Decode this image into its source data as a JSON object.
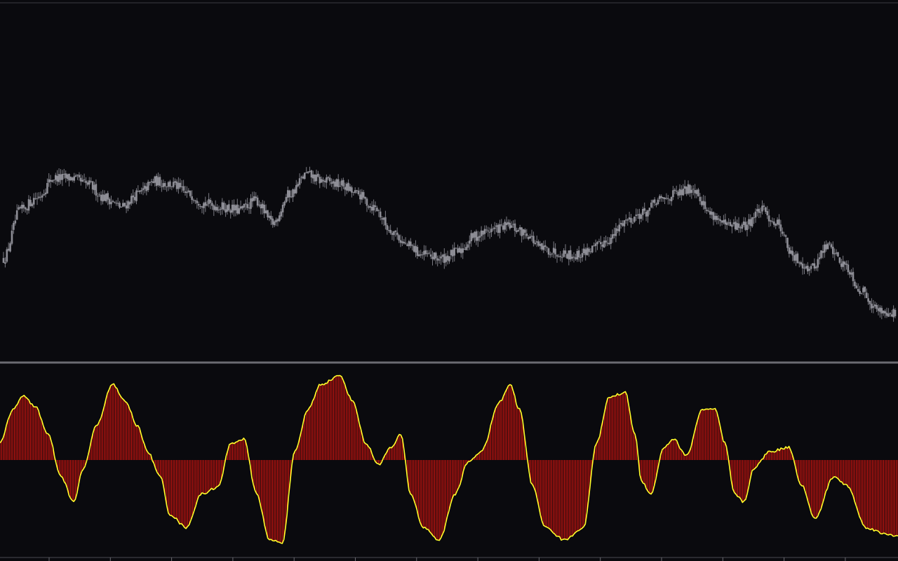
{
  "theme": {
    "background": "#0a0a0e",
    "separator": "#6b6b72",
    "candle": "#8e8e96",
    "wick": "#7a7a82",
    "histogram": "#e0140f",
    "signal": "#ffff2a"
  },
  "chart_data": [
    {
      "type": "candlestick",
      "grid": false,
      "legend": "none",
      "ylim": [
        0,
        100
      ],
      "close_anchors": [
        [
          0,
          22
        ],
        [
          10,
          37
        ],
        [
          20,
          41
        ],
        [
          30,
          47
        ],
        [
          40,
          47
        ],
        [
          50,
          45
        ],
        [
          60,
          41
        ],
        [
          70,
          38
        ],
        [
          80,
          42
        ],
        [
          90,
          46
        ],
        [
          100,
          45
        ],
        [
          110,
          42
        ],
        [
          120,
          39
        ],
        [
          130,
          38
        ],
        [
          140,
          37
        ],
        [
          150,
          40
        ],
        [
          160,
          33
        ],
        [
          170,
          42
        ],
        [
          180,
          48
        ],
        [
          190,
          46
        ],
        [
          200,
          45
        ],
        [
          210,
          42
        ],
        [
          220,
          38
        ],
        [
          230,
          31
        ],
        [
          240,
          26
        ],
        [
          250,
          23
        ],
        [
          260,
          22
        ],
        [
          270,
          24
        ],
        [
          280,
          29
        ],
        [
          290,
          31
        ],
        [
          300,
          32
        ],
        [
          310,
          30
        ],
        [
          320,
          25
        ],
        [
          330,
          24
        ],
        [
          340,
          23
        ],
        [
          350,
          25
        ],
        [
          360,
          28
        ],
        [
          370,
          34
        ],
        [
          380,
          36
        ],
        [
          390,
          40
        ],
        [
          400,
          42
        ],
        [
          410,
          44
        ],
        [
          420,
          36
        ],
        [
          430,
          32
        ],
        [
          440,
          32
        ],
        [
          450,
          37
        ],
        [
          460,
          33
        ],
        [
          470,
          22
        ],
        [
          480,
          19
        ],
        [
          490,
          26
        ],
        [
          500,
          20
        ],
        [
          510,
          12
        ],
        [
          520,
          6
        ],
        [
          530,
          5
        ]
      ],
      "ohlc_noise": 2.0
    },
    {
      "type": "histogram+line",
      "grid": false,
      "legend": "none",
      "ylim": [
        -1,
        1
      ],
      "zero": 0,
      "series": [
        {
          "style": "histogram",
          "anchors": [
            [
              0,
              0.2
            ],
            [
              8,
              0.6
            ],
            [
              14,
              0.76
            ],
            [
              22,
              0.64
            ],
            [
              30,
              0.3
            ],
            [
              38,
              -0.2
            ],
            [
              46,
              -0.5
            ],
            [
              52,
              -0.1
            ],
            [
              60,
              0.4
            ],
            [
              70,
              0.9
            ],
            [
              78,
              0.7
            ],
            [
              86,
              0.4
            ],
            [
              92,
              0.1
            ],
            [
              100,
              -0.2
            ],
            [
              106,
              -0.65
            ],
            [
              116,
              -0.8
            ],
            [
              126,
              -0.4
            ],
            [
              136,
              -0.32
            ],
            [
              144,
              0.2
            ],
            [
              152,
              0.25
            ],
            [
              160,
              -0.4
            ],
            [
              168,
              -0.95
            ],
            [
              176,
              -0.98
            ],
            [
              184,
              0.1
            ],
            [
              192,
              0.6
            ],
            [
              200,
              0.9
            ],
            [
              212,
              1.0
            ],
            [
              220,
              0.7
            ],
            [
              228,
              0.2
            ],
            [
              236,
              -0.05
            ],
            [
              244,
              0.15
            ],
            [
              250,
              0.3
            ],
            [
              256,
              -0.4
            ],
            [
              264,
              -0.8
            ],
            [
              274,
              -0.95
            ],
            [
              284,
              -0.4
            ],
            [
              292,
              -0.02
            ],
            [
              300,
              0.1
            ],
            [
              312,
              0.7
            ],
            [
              318,
              0.9
            ],
            [
              324,
              0.6
            ],
            [
              332,
              -0.3
            ],
            [
              340,
              -0.8
            ],
            [
              352,
              -0.95
            ],
            [
              364,
              -0.8
            ],
            [
              372,
              0.2
            ],
            [
              380,
              0.75
            ],
            [
              390,
              0.8
            ],
            [
              396,
              0.3
            ],
            [
              400,
              -0.25
            ],
            [
              406,
              -0.4
            ],
            [
              414,
              0.15
            ],
            [
              420,
              0.25
            ],
            [
              428,
              0.05
            ],
            [
              438,
              0.6
            ],
            [
              446,
              0.6
            ],
            [
              452,
              0.2
            ],
            [
              458,
              -0.4
            ],
            [
              464,
              -0.5
            ],
            [
              470,
              -0.1
            ],
            [
              480,
              0.1
            ],
            [
              492,
              0.15
            ],
            [
              500,
              -0.3
            ],
            [
              508,
              -0.7
            ],
            [
              520,
              -0.2
            ],
            [
              528,
              -0.3
            ],
            [
              540,
              -0.8
            ],
            [
              552,
              -0.88
            ],
            [
              560,
              -0.9
            ]
          ]
        },
        {
          "style": "line",
          "source": "histogram"
        }
      ]
    }
  ]
}
